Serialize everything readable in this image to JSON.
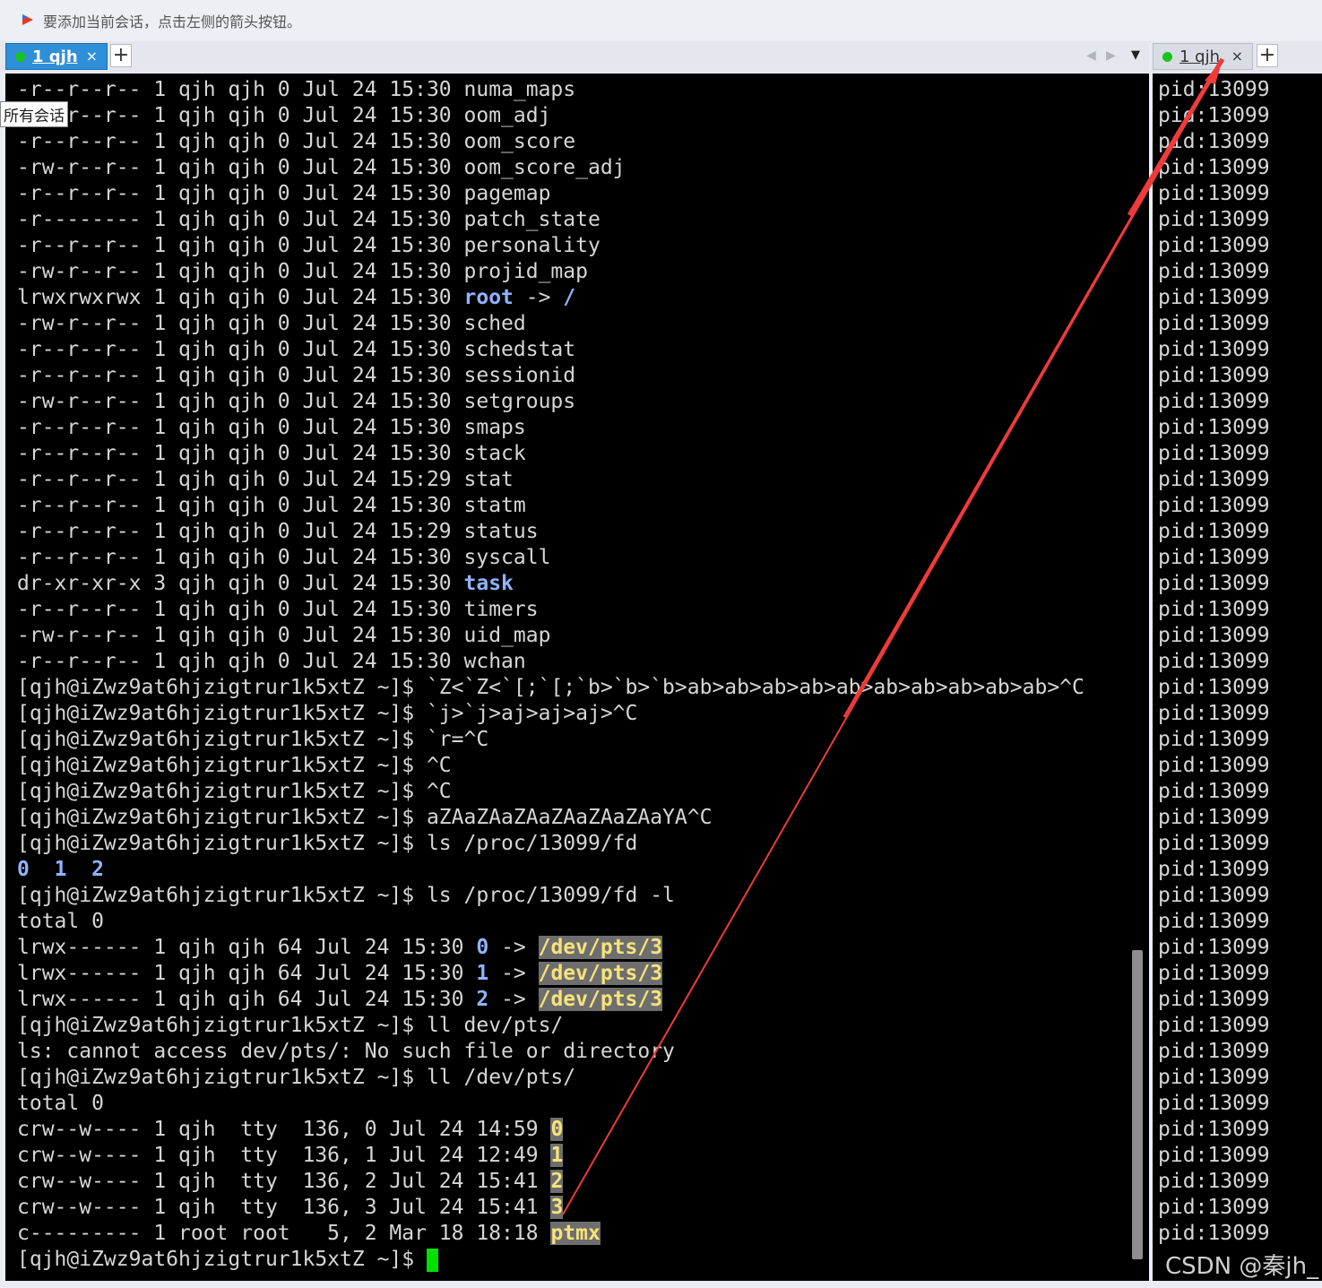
{
  "hint_bar": {
    "text": "要添加当前会话，点击左侧的箭头按钮。",
    "icon": "flag-icon"
  },
  "left_tab": {
    "label": "1 qjh",
    "close": "×",
    "status_color": "#1bc41b"
  },
  "right_tab": {
    "label": "1 qjh",
    "close": "×"
  },
  "plus_label": "+",
  "nav": {
    "prev": "◀",
    "next": "▶",
    "dropdown": "▼"
  },
  "tooltip": "所有会话",
  "watermark": "CSDN @秦jh_",
  "left_terminal": [
    [
      {
        "t": "-r--r--r-- 1 qjh qjh 0 Jul 24 15:30 numa_maps"
      }
    ],
    [
      {
        "t": "-rw-r--r-- 1 qjh qjh 0 Jul 24 15:30 oom_adj"
      }
    ],
    [
      {
        "t": "-r--r--r-- 1 qjh qjh 0 Jul 24 15:30 oom_score"
      }
    ],
    [
      {
        "t": "-rw-r--r-- 1 qjh qjh 0 Jul 24 15:30 oom_score_adj"
      }
    ],
    [
      {
        "t": "-r--r--r-- 1 qjh qjh 0 Jul 24 15:30 pagemap"
      }
    ],
    [
      {
        "t": "-r-------- 1 qjh qjh 0 Jul 24 15:30 patch_state"
      }
    ],
    [
      {
        "t": "-r--r--r-- 1 qjh qjh 0 Jul 24 15:30 personality"
      }
    ],
    [
      {
        "t": "-rw-r--r-- 1 qjh qjh 0 Jul 24 15:30 projid_map"
      }
    ],
    [
      {
        "t": "lrwxrwxrwx 1 qjh qjh 0 Jul 24 15:30 "
      },
      {
        "t": "root",
        "c": "blue"
      },
      {
        "t": " -> "
      },
      {
        "t": "/",
        "c": "blue"
      }
    ],
    [
      {
        "t": "-rw-r--r-- 1 qjh qjh 0 Jul 24 15:30 sched"
      }
    ],
    [
      {
        "t": "-r--r--r-- 1 qjh qjh 0 Jul 24 15:30 schedstat"
      }
    ],
    [
      {
        "t": "-r--r--r-- 1 qjh qjh 0 Jul 24 15:30 sessionid"
      }
    ],
    [
      {
        "t": "-rw-r--r-- 1 qjh qjh 0 Jul 24 15:30 setgroups"
      }
    ],
    [
      {
        "t": "-r--r--r-- 1 qjh qjh 0 Jul 24 15:30 smaps"
      }
    ],
    [
      {
        "t": "-r--r--r-- 1 qjh qjh 0 Jul 24 15:30 stack"
      }
    ],
    [
      {
        "t": "-r--r--r-- 1 qjh qjh 0 Jul 24 15:29 stat"
      }
    ],
    [
      {
        "t": "-r--r--r-- 1 qjh qjh 0 Jul 24 15:30 statm"
      }
    ],
    [
      {
        "t": "-r--r--r-- 1 qjh qjh 0 Jul 24 15:29 status"
      }
    ],
    [
      {
        "t": "-r--r--r-- 1 qjh qjh 0 Jul 24 15:30 syscall"
      }
    ],
    [
      {
        "t": "dr-xr-xr-x 3 qjh qjh 0 Jul 24 15:30 "
      },
      {
        "t": "task",
        "c": "blue"
      }
    ],
    [
      {
        "t": "-r--r--r-- 1 qjh qjh 0 Jul 24 15:30 timers"
      }
    ],
    [
      {
        "t": "-rw-r--r-- 1 qjh qjh 0 Jul 24 15:30 uid_map"
      }
    ],
    [
      {
        "t": "-r--r--r-- 1 qjh qjh 0 Jul 24 15:30 wchan"
      }
    ],
    [
      {
        "t": "[qjh@iZwz9at6hjzigtrur1k5xtZ ~]$ `Z<`Z<`[;`[;`b>`b>`b>ab>ab>ab>ab>ab>ab>ab>ab>ab>ab>^C"
      }
    ],
    [
      {
        "t": "[qjh@iZwz9at6hjzigtrur1k5xtZ ~]$ `j>`j>aj>aj>aj>^C"
      }
    ],
    [
      {
        "t": "[qjh@iZwz9at6hjzigtrur1k5xtZ ~]$ `r=^C"
      }
    ],
    [
      {
        "t": "[qjh@iZwz9at6hjzigtrur1k5xtZ ~]$ ^C"
      }
    ],
    [
      {
        "t": "[qjh@iZwz9at6hjzigtrur1k5xtZ ~]$ ^C"
      }
    ],
    [
      {
        "t": "[qjh@iZwz9at6hjzigtrur1k5xtZ ~]$ aZAaZAaZAaZAaZAaZAaYA^C"
      }
    ],
    [
      {
        "t": "[qjh@iZwz9at6hjzigtrur1k5xtZ ~]$ ls /proc/13099/fd"
      }
    ],
    [
      {
        "t": "0",
        "c": "blue"
      },
      {
        "t": "  "
      },
      {
        "t": "1",
        "c": "blue"
      },
      {
        "t": "  "
      },
      {
        "t": "2",
        "c": "blue"
      }
    ],
    [
      {
        "t": "[qjh@iZwz9at6hjzigtrur1k5xtZ ~]$ ls /proc/13099/fd -l"
      }
    ],
    [
      {
        "t": "total 0"
      }
    ],
    [
      {
        "t": "lrwx------ 1 qjh qjh 64 Jul 24 15:30 "
      },
      {
        "t": "0",
        "c": "blue"
      },
      {
        "t": " -> "
      },
      {
        "t": "/dev/pts/3",
        "c": "hl"
      }
    ],
    [
      {
        "t": "lrwx------ 1 qjh qjh 64 Jul 24 15:30 "
      },
      {
        "t": "1",
        "c": "blue"
      },
      {
        "t": " -> "
      },
      {
        "t": "/dev/pts/3",
        "c": "hl"
      }
    ],
    [
      {
        "t": "lrwx------ 1 qjh qjh 64 Jul 24 15:30 "
      },
      {
        "t": "2",
        "c": "blue"
      },
      {
        "t": " -> "
      },
      {
        "t": "/dev/pts/3",
        "c": "hl"
      }
    ],
    [
      {
        "t": "[qjh@iZwz9at6hjzigtrur1k5xtZ ~]$ ll dev/pts/"
      }
    ],
    [
      {
        "t": "ls: cannot access dev/pts/: No such file or directory"
      }
    ],
    [
      {
        "t": "[qjh@iZwz9at6hjzigtrur1k5xtZ ~]$ ll /dev/pts/"
      }
    ],
    [
      {
        "t": "total 0"
      }
    ],
    [
      {
        "t": "crw--w---- 1 qjh  tty  136, 0 Jul 24 14:59 "
      },
      {
        "t": "0",
        "c": "hl"
      }
    ],
    [
      {
        "t": "crw--w---- 1 qjh  tty  136, 1 Jul 24 12:49 "
      },
      {
        "t": "1",
        "c": "hl"
      }
    ],
    [
      {
        "t": "crw--w---- 1 qjh  tty  136, 2 Jul 24 15:41 "
      },
      {
        "t": "2",
        "c": "hl"
      }
    ],
    [
      {
        "t": "crw--w---- 1 qjh  tty  136, 3 Jul 24 15:41 "
      },
      {
        "t": "3",
        "c": "hl"
      }
    ],
    [
      {
        "t": "c--------- 1 root root   5, 2 Mar 18 18:18 "
      },
      {
        "t": "ptmx",
        "c": "hl"
      }
    ],
    [
      {
        "t": "[qjh@iZwz9at6hjzigtrur1k5xtZ ~]$ "
      },
      {
        "t": "",
        "c": "cursor"
      }
    ]
  ],
  "right_terminal": {
    "line_text": "pid:13099",
    "line_count": 45
  }
}
